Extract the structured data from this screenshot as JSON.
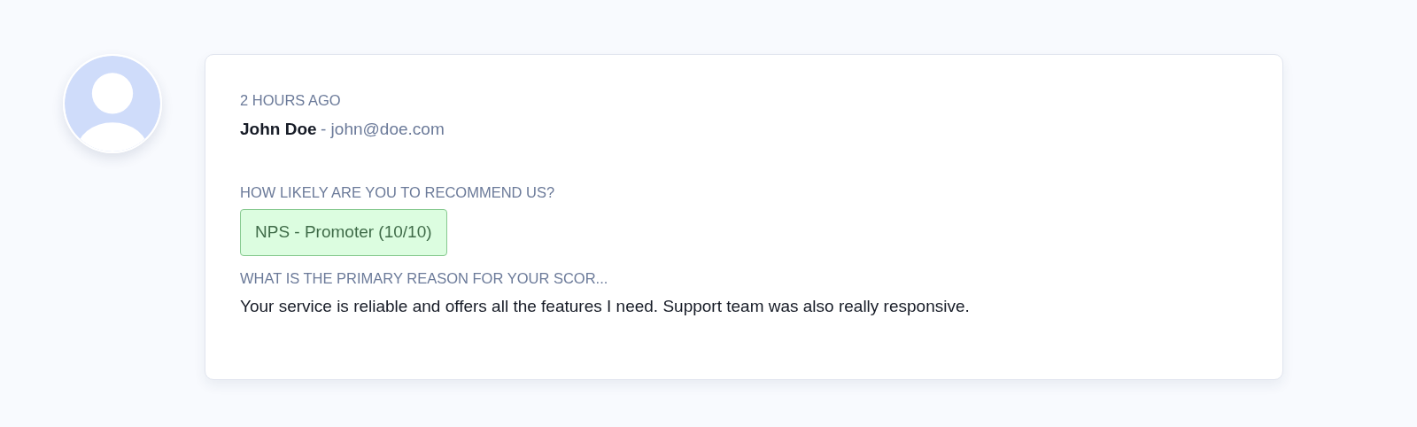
{
  "response": {
    "time": "2 HOURS AGO",
    "name": "John Doe",
    "email": "- john@doe.com",
    "answers": [
      {
        "question": "HOW LIKELY ARE YOU TO RECOMMEND US?",
        "kind": "badge",
        "answer": "NPS - Promoter (10/10)"
      },
      {
        "question": "WHAT IS THE PRIMARY REASON FOR YOUR SCOR...",
        "kind": "text",
        "answer": "Your service is reliable and offers all the features I need. Support team was also really responsive."
      }
    ]
  }
}
